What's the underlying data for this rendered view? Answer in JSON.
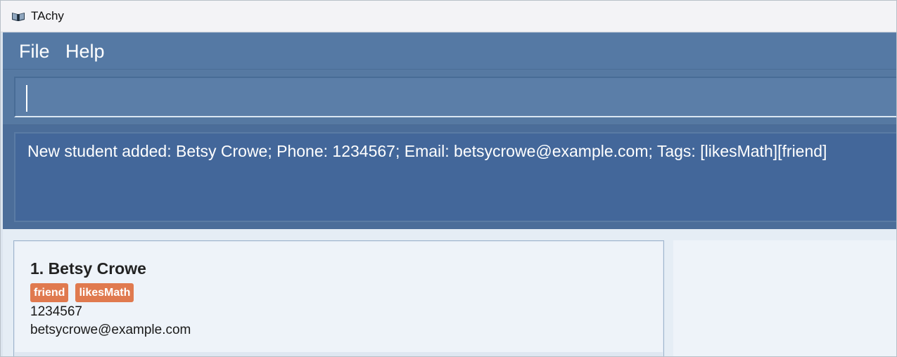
{
  "window": {
    "title": "TAchy",
    "icon": "open-book-icon"
  },
  "menu": {
    "file": "File",
    "help": "Help"
  },
  "command": {
    "value": "",
    "placeholder": ""
  },
  "result": {
    "message": "New student added: Betsy Crowe; Phone: 1234567; Email: betsycrowe@example.com; Tags: [likesMath][friend]"
  },
  "students": [
    {
      "index": "1.",
      "name": "Betsy Crowe",
      "display_name": "1. Betsy Crowe",
      "tags": [
        "friend",
        "likesMath"
      ],
      "phone": "1234567",
      "email": "betsycrowe@example.com"
    }
  ],
  "colors": {
    "menu_bar": "#5579a4",
    "result_box": "#43679a",
    "tag": "#e07a4f",
    "list_background": "#eef3f9"
  }
}
